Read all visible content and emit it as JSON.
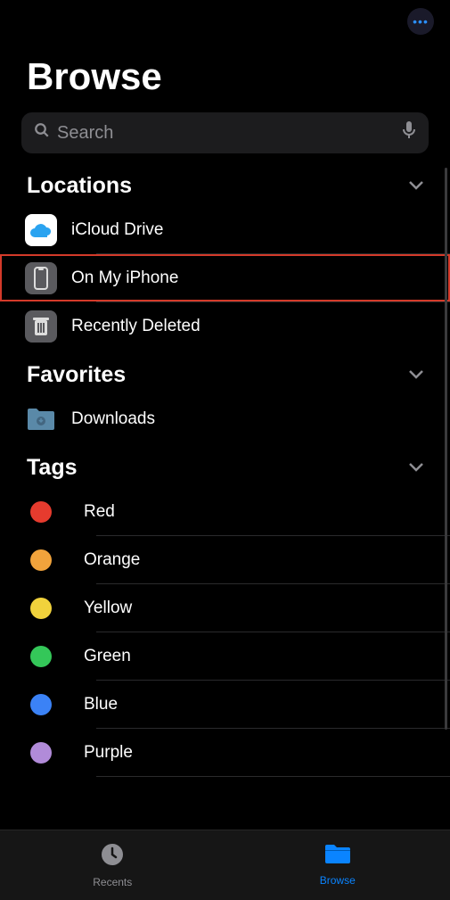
{
  "header": {
    "title": "Browse",
    "more_glyph": "•••"
  },
  "search": {
    "placeholder": "Search"
  },
  "sections": {
    "locations": {
      "title": "Locations",
      "items": [
        {
          "label": "iCloud Drive"
        },
        {
          "label": "On My iPhone"
        },
        {
          "label": "Recently Deleted"
        }
      ]
    },
    "favorites": {
      "title": "Favorites",
      "items": [
        {
          "label": "Downloads"
        }
      ]
    },
    "tags": {
      "title": "Tags",
      "items": [
        {
          "label": "Red",
          "color": "#e63b2e"
        },
        {
          "label": "Orange",
          "color": "#f1a33c"
        },
        {
          "label": "Yellow",
          "color": "#f1d23c"
        },
        {
          "label": "Green",
          "color": "#34c759"
        },
        {
          "label": "Blue",
          "color": "#3b82f6"
        },
        {
          "label": "Purple",
          "color": "#b18bd9"
        }
      ]
    }
  },
  "tabs": {
    "recents": "Recents",
    "browse": "Browse"
  }
}
